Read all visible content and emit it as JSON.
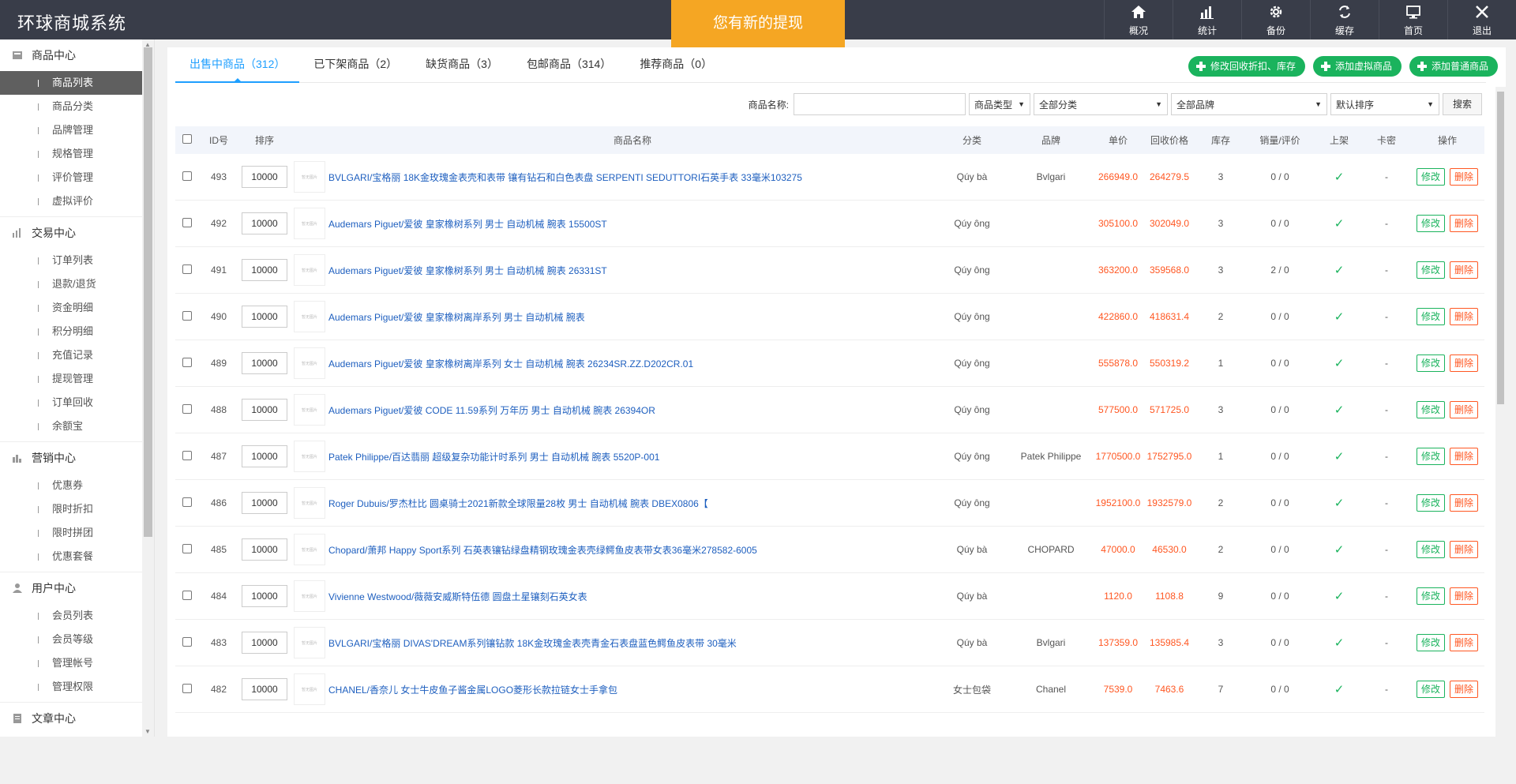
{
  "app": {
    "title": "环球商城系统"
  },
  "notice": {
    "text": "您有新的提现"
  },
  "topnav": [
    {
      "label": "概况",
      "icon": "home-icon"
    },
    {
      "label": "统计",
      "icon": "bar-chart-icon"
    },
    {
      "label": "备份",
      "icon": "gear-icon"
    },
    {
      "label": "缓存",
      "icon": "refresh-icon"
    },
    {
      "label": "首页",
      "icon": "monitor-icon"
    },
    {
      "label": "退出",
      "icon": "close-icon"
    }
  ],
  "sidebar": [
    {
      "title": "商品中心",
      "icon": "box-icon",
      "items": [
        "商品列表",
        "商品分类",
        "品牌管理",
        "规格管理",
        "评价管理",
        "虚拟评价"
      ]
    },
    {
      "title": "交易中心",
      "icon": "bar-chart-icon",
      "items": [
        "订单列表",
        "退款/退货",
        "资金明细",
        "积分明细",
        "充值记录",
        "提现管理",
        "订单回收",
        "余额宝"
      ]
    },
    {
      "title": "营销中心",
      "icon": "chart-icon",
      "items": [
        "优惠券",
        "限时折扣",
        "限时拼团",
        "优惠套餐"
      ]
    },
    {
      "title": "用户中心",
      "icon": "user-icon",
      "items": [
        "会员列表",
        "会员等级",
        "管理帐号",
        "管理权限"
      ]
    },
    {
      "title": "文章中心",
      "icon": "document-icon",
      "items": []
    }
  ],
  "tabs": [
    "出售中商品（312）",
    "已下架商品（2）",
    "缺货商品（3）",
    "包邮商品（314）",
    "推荐商品（0）"
  ],
  "actions": [
    "修改回收折扣、库存",
    "添加虚拟商品",
    "添加普通商品"
  ],
  "filters": {
    "name_label": "商品名称:",
    "name_value": "",
    "type": "商品类型",
    "category": "全部分类",
    "brand": "全部品牌",
    "sort": "默认排序",
    "search": "搜索"
  },
  "table": {
    "headers": {
      "id": "ID号",
      "sort": "排序",
      "name": "商品名称",
      "cat": "分类",
      "brand": "品牌",
      "price": "单价",
      "rprice": "回收价格",
      "stock": "库存",
      "sales": "销量/评价",
      "shelf": "上架",
      "card": "卡密",
      "op": "操作"
    },
    "img_placeholder": "暂无图片",
    "edit_label": "修改",
    "delete_label": "删除",
    "rows": [
      {
        "id": "493",
        "sort": "10000",
        "name": "BVLGARI/宝格丽 18K金玫瑰金表壳和表带 镶有钻石和白色表盘 SERPENTI SEDUTTORI石英手表 33毫米103275",
        "cat": "Qúy bà",
        "brand": "Bvlgari",
        "price": "266949.0",
        "rprice": "264279.5",
        "stock": "3",
        "sales": "0 / 0",
        "card": "-"
      },
      {
        "id": "492",
        "sort": "10000",
        "name": "Audemars Piguet/爱彼 皇家橡树系列 男士 自动机械 腕表 15500ST",
        "cat": "Qúy ông",
        "brand": "",
        "price": "305100.0",
        "rprice": "302049.0",
        "stock": "3",
        "sales": "0 / 0",
        "card": "-"
      },
      {
        "id": "491",
        "sort": "10000",
        "name": "Audemars Piguet/爱彼 皇家橡树系列 男士 自动机械 腕表 26331ST",
        "cat": "Qúy ông",
        "brand": "",
        "price": "363200.0",
        "rprice": "359568.0",
        "stock": "3",
        "sales": "2 / 0",
        "card": "-"
      },
      {
        "id": "490",
        "sort": "10000",
        "name": "Audemars Piguet/爱彼 皇家橡树离岸系列 男士 自动机械 腕表",
        "cat": "Qúy ông",
        "brand": "",
        "price": "422860.0",
        "rprice": "418631.4",
        "stock": "2",
        "sales": "0 / 0",
        "card": "-"
      },
      {
        "id": "489",
        "sort": "10000",
        "name": "Audemars Piguet/爱彼 皇家橡树离岸系列 女士 自动机械 腕表 26234SR.ZZ.D202CR.01",
        "cat": "Qúy ông",
        "brand": "",
        "price": "555878.0",
        "rprice": "550319.2",
        "stock": "1",
        "sales": "0 / 0",
        "card": "-"
      },
      {
        "id": "488",
        "sort": "10000",
        "name": "Audemars Piguet/爱彼 CODE 11.59系列 万年历 男士 自动机械 腕表 26394OR",
        "cat": "Qúy ông",
        "brand": "",
        "price": "577500.0",
        "rprice": "571725.0",
        "stock": "3",
        "sales": "0 / 0",
        "card": "-"
      },
      {
        "id": "487",
        "sort": "10000",
        "name": "Patek Philippe/百达翡丽 超级复杂功能计时系列 男士 自动机械 腕表 5520P-001",
        "cat": "Qúy ông",
        "brand": "Patek Philippe",
        "price": "1770500.0",
        "rprice": "1752795.0",
        "stock": "1",
        "sales": "0 / 0",
        "card": "-"
      },
      {
        "id": "486",
        "sort": "10000",
        "name": "Roger Dubuis/罗杰杜比 圆桌骑士2021新款全球限量28枚 男士 自动机械 腕表 DBEX0806【",
        "cat": "Qúy ông",
        "brand": "",
        "price": "1952100.0",
        "rprice": "1932579.0",
        "stock": "2",
        "sales": "0 / 0",
        "card": "-"
      },
      {
        "id": "485",
        "sort": "10000",
        "name": "Chopard/萧邦 Happy Sport系列 石英表镶钻绿盘精钢玫瑰金表壳绿鳄鱼皮表带女表36毫米278582-6005",
        "cat": "Qúy bà",
        "brand": "CHOPARD",
        "price": "47000.0",
        "rprice": "46530.0",
        "stock": "2",
        "sales": "0 / 0",
        "card": "-"
      },
      {
        "id": "484",
        "sort": "10000",
        "name": "Vivienne Westwood/薇薇安威斯特伍德 圆盘土星镶刻石英女表",
        "cat": "Qúy bà",
        "brand": "",
        "price": "1120.0",
        "rprice": "1108.8",
        "stock": "9",
        "sales": "0 / 0",
        "card": "-"
      },
      {
        "id": "483",
        "sort": "10000",
        "name": "BVLGARI/宝格丽 DIVAS'DREAM系列镶钻款 18K金玫瑰金表壳青金石表盘蓝色鳄鱼皮表带 30毫米",
        "cat": "Qúy bà",
        "brand": "Bvlgari",
        "price": "137359.0",
        "rprice": "135985.4",
        "stock": "3",
        "sales": "0 / 0",
        "card": "-"
      },
      {
        "id": "482",
        "sort": "10000",
        "name": "CHANEL/香奈儿 女士牛皮鱼子酱金属LOGO菱形长款拉链女士手拿包",
        "cat": "女士包袋",
        "brand": "Chanel",
        "price": "7539.0",
        "rprice": "7463.6",
        "stock": "7",
        "sales": "0 / 0",
        "card": "-"
      }
    ]
  }
}
